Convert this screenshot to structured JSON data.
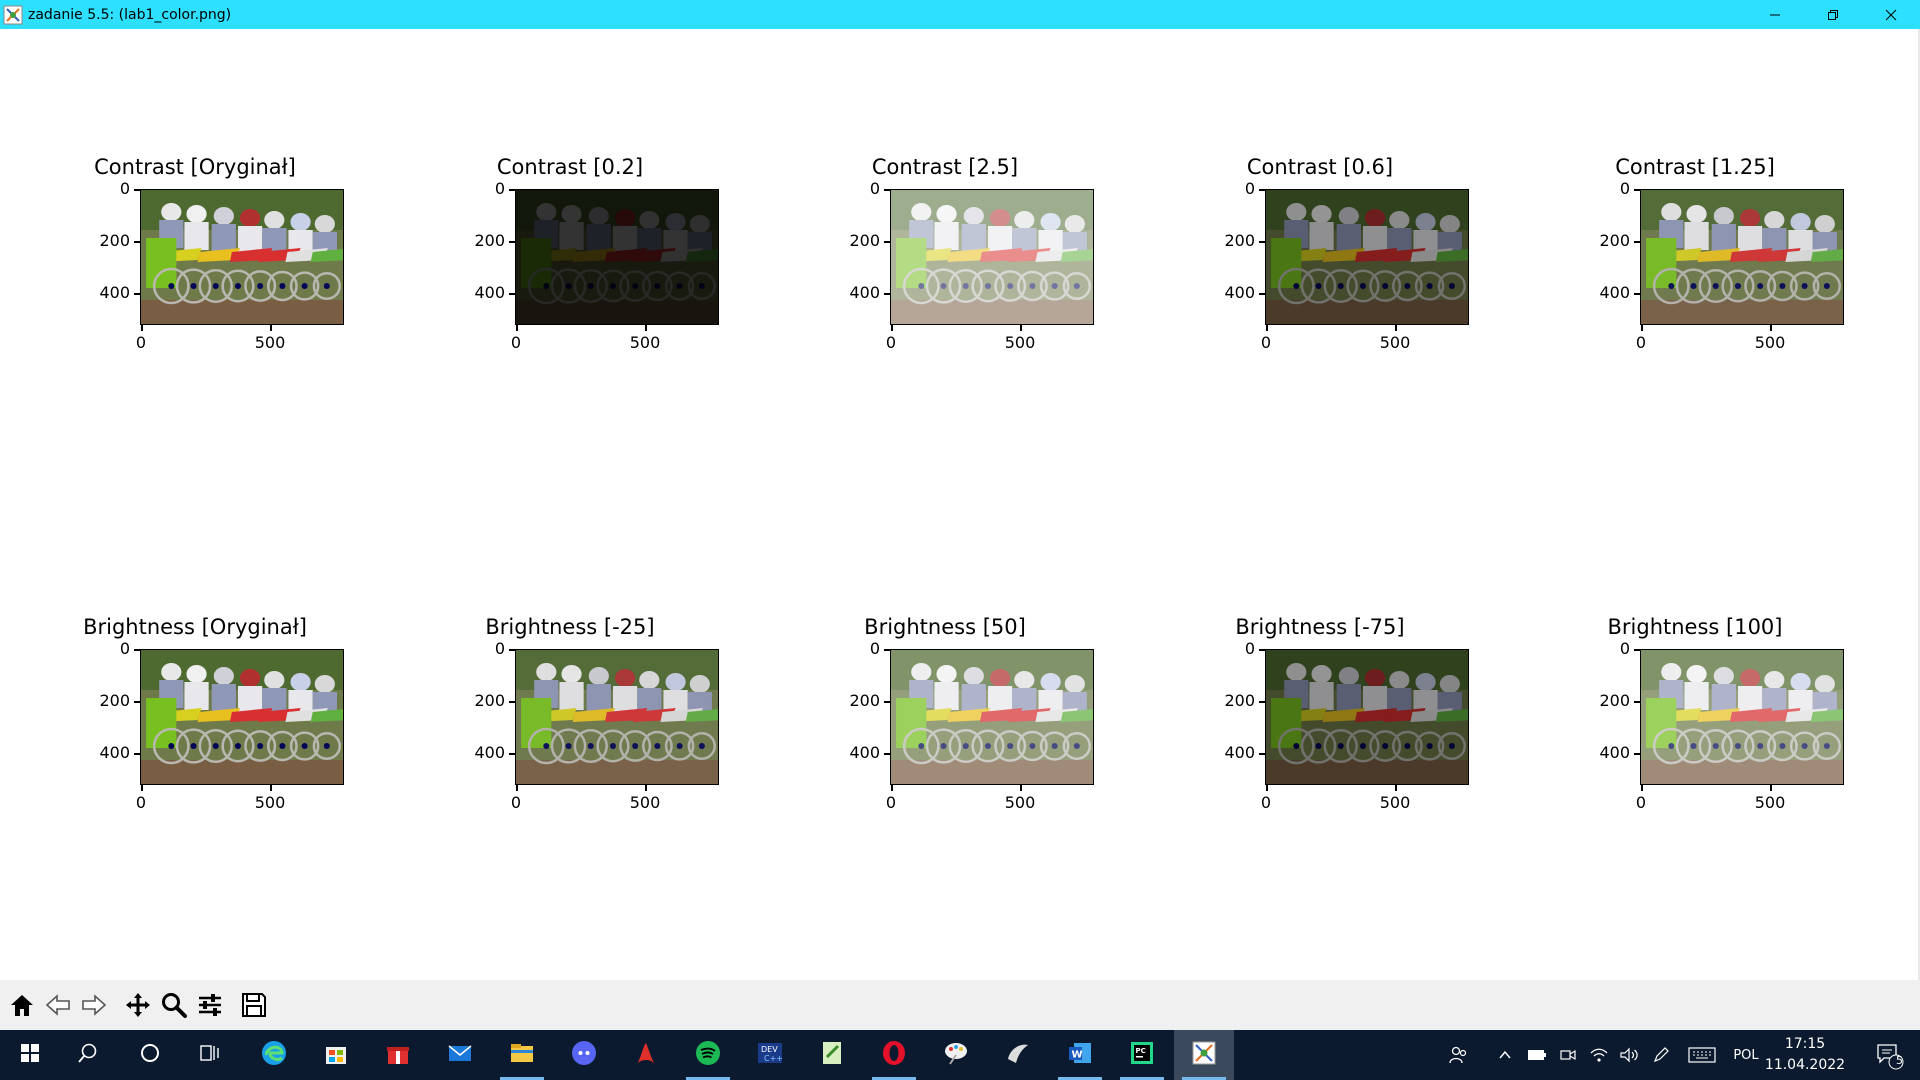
{
  "window": {
    "title": "zadanie 5.5: (lab1_color.png)"
  },
  "figure": {
    "rows": [
      {
        "panels": [
          {
            "title": "Contrast [Oryginał]",
            "tone": "orig"
          },
          {
            "title": "Contrast [0.2]",
            "tone": "dark"
          },
          {
            "title": "Contrast [2.5]",
            "tone": "high"
          },
          {
            "title": "Contrast [0.6]",
            "tone": "dim"
          },
          {
            "title": "Contrast [1.25]",
            "tone": "mid"
          }
        ]
      },
      {
        "panels": [
          {
            "title": "Brightness [Oryginał]",
            "tone": "orig"
          },
          {
            "title": "Brightness [-25]",
            "tone": "mid"
          },
          {
            "title": "Brightness [50]",
            "tone": "bright"
          },
          {
            "title": "Brightness [-75]",
            "tone": "dim"
          },
          {
            "title": "Brightness [100]",
            "tone": "bright"
          }
        ]
      }
    ],
    "yticks": [
      "0",
      "200",
      "400"
    ],
    "xticks": [
      "0",
      "500"
    ]
  },
  "toolbar": {
    "buttons": [
      "home-icon",
      "back-icon",
      "forward-icon",
      "pan-icon",
      "zoom-icon",
      "configure-subplots-icon",
      "save-icon"
    ]
  },
  "taskbar": {
    "apps": [
      "start-icon",
      "search-icon",
      "cortana-icon",
      "task-view-icon",
      "edge-icon",
      "store-icon",
      "gift-icon",
      "mail-icon",
      "file-explorer-icon",
      "discord-icon",
      "pdf-icon",
      "spotify-icon",
      "dev-c-icon",
      "notepad-icon",
      "opera-icon",
      "paint-icon",
      "terminal-icon",
      "word-icon",
      "pycharm-icon",
      "python-figure-icon"
    ],
    "language": "POL",
    "time": "17:15",
    "date": "11.04.2022",
    "notification_count": "5"
  }
}
